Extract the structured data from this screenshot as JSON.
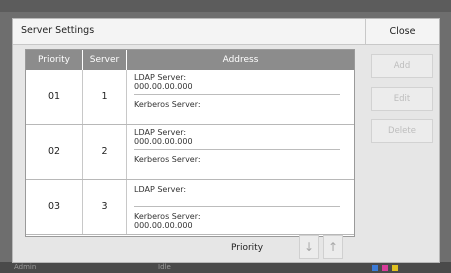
{
  "dialog": {
    "title": "Server Settings",
    "close_label": "Close"
  },
  "table": {
    "headers": {
      "priority": "Priority",
      "server": "Server",
      "address": "Address"
    },
    "rows": [
      {
        "priority": "01",
        "server": "1",
        "ldap_label": "LDAP Server:",
        "ldap_value": "000.00.00.000",
        "kerberos_label": "Kerberos Server:",
        "kerberos_value": ""
      },
      {
        "priority": "02",
        "server": "2",
        "ldap_label": "LDAP Server:",
        "ldap_value": "000.00.00.000",
        "kerberos_label": "Kerberos Server:",
        "kerberos_value": ""
      },
      {
        "priority": "03",
        "server": "3",
        "ldap_label": "LDAP Server:",
        "ldap_value": "",
        "kerberos_label": "Kerberos Server:",
        "kerberos_value": "000.00.00.000"
      }
    ]
  },
  "side_buttons": {
    "add": "Add",
    "edit": "Edit",
    "delete": "Delete"
  },
  "priority_control": {
    "label": "Priority",
    "down_icon": "↓",
    "up_icon": "↑"
  },
  "backdrop": {
    "left_text": "Admin",
    "mid_text": "Idle"
  },
  "colors": {
    "header_bg": "#8c8c8c",
    "disabled_text": "#bdbdbd"
  }
}
